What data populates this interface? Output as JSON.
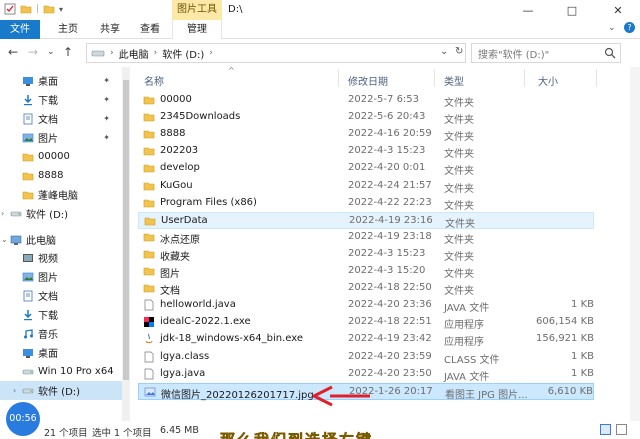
{
  "window": {
    "tools_tab": "图片工具",
    "title": "D:\\",
    "controls": [
      "—",
      "□",
      "✕"
    ]
  },
  "ribbon": {
    "tabs": [
      "文件",
      "主页",
      "共享",
      "查看",
      "管理"
    ]
  },
  "address": {
    "crumbs": [
      "此电脑",
      "软件 (D:)"
    ],
    "search_placeholder": "搜索\"软件 (D:)\""
  },
  "sidebar": {
    "items": [
      {
        "label": "桌面",
        "icon": "desktop-icon",
        "pinned": true
      },
      {
        "label": "下载",
        "icon": "download-icon",
        "pinned": true
      },
      {
        "label": "文档",
        "icon": "document-icon",
        "pinned": true
      },
      {
        "label": "图片",
        "icon": "picture-icon",
        "pinned": true
      },
      {
        "label": "00000",
        "icon": "folder-icon",
        "pinned": false
      },
      {
        "label": "8888",
        "icon": "folder-icon",
        "pinned": false
      },
      {
        "label": "蓬峰电脑",
        "icon": "folder-icon",
        "pinned": false
      },
      {
        "label": "软件 (D:)",
        "icon": "drive-icon",
        "pinned": false
      },
      {
        "label": "此电脑",
        "icon": "computer-icon",
        "pinned": false
      },
      {
        "label": "视频",
        "icon": "video-icon",
        "pinned": false
      },
      {
        "label": "图片",
        "icon": "picture-icon",
        "pinned": false
      },
      {
        "label": "文档",
        "icon": "document-icon",
        "pinned": false
      },
      {
        "label": "下载",
        "icon": "download-icon",
        "pinned": false
      },
      {
        "label": "音乐",
        "icon": "music-icon",
        "pinned": false
      },
      {
        "label": "桌面",
        "icon": "desktop-icon",
        "pinned": false
      },
      {
        "label": "Win 10 Pro x64",
        "icon": "drive-icon",
        "pinned": false
      },
      {
        "label": "软件 (D:)",
        "icon": "drive-icon",
        "pinned": false
      }
    ]
  },
  "columns": {
    "name": "名称",
    "date": "修改日期",
    "type": "类型",
    "size": "大小"
  },
  "files": [
    {
      "name": "00000",
      "date": "2022-5-7 6:53",
      "type": "文件夹",
      "size": "",
      "icon": "folder-icon"
    },
    {
      "name": "2345Downloads",
      "date": "2022-5-6 20:43",
      "type": "文件夹",
      "size": "",
      "icon": "folder-icon"
    },
    {
      "name": "8888",
      "date": "2022-4-16 20:59",
      "type": "文件夹",
      "size": "",
      "icon": "folder-icon"
    },
    {
      "name": "202203",
      "date": "2022-4-3 15:23",
      "type": "文件夹",
      "size": "",
      "icon": "folder-icon"
    },
    {
      "name": "develop",
      "date": "2022-4-20 0:01",
      "type": "文件夹",
      "size": "",
      "icon": "folder-icon"
    },
    {
      "name": "KuGou",
      "date": "2022-4-24 21:57",
      "type": "文件夹",
      "size": "",
      "icon": "folder-icon"
    },
    {
      "name": "Program Files (x86)",
      "date": "2022-4-22 22:23",
      "type": "文件夹",
      "size": "",
      "icon": "folder-icon"
    },
    {
      "name": "UserData",
      "date": "2022-4-19 23:16",
      "type": "文件夹",
      "size": "",
      "icon": "folder-icon"
    },
    {
      "name": "冰点还原",
      "date": "2022-4-19 23:18",
      "type": "文件夹",
      "size": "",
      "icon": "folder-icon"
    },
    {
      "name": "收藏夹",
      "date": "2022-4-3 15:23",
      "type": "文件夹",
      "size": "",
      "icon": "folder-icon"
    },
    {
      "name": "图片",
      "date": "2022-4-3 15:20",
      "type": "文件夹",
      "size": "",
      "icon": "folder-icon"
    },
    {
      "name": "文档",
      "date": "2022-4-18 22:50",
      "type": "文件夹",
      "size": "",
      "icon": "folder-icon"
    },
    {
      "name": "helloworld.java",
      "date": "2022-4-20 23:36",
      "type": "JAVA 文件",
      "size": "1 KB",
      "icon": "java-file-icon"
    },
    {
      "name": "idealC-2022.1.exe",
      "date": "2022-4-18 22:51",
      "type": "应用程序",
      "size": "606,154 KB",
      "icon": "idea-exe-icon"
    },
    {
      "name": "jdk-18_windows-x64_bin.exe",
      "date": "2022-4-19 23:42",
      "type": "应用程序",
      "size": "156,921 KB",
      "icon": "jdk-exe-icon"
    },
    {
      "name": "lgya.class",
      "date": "2022-4-20 23:59",
      "type": "CLASS 文件",
      "size": "1 KB",
      "icon": "class-file-icon"
    },
    {
      "name": "lgya.java",
      "date": "2022-4-20 23:50",
      "type": "JAVA 文件",
      "size": "1 KB",
      "icon": "java-file-icon"
    },
    {
      "name": "微信图片_20220126201717.jpg",
      "date": "2022-1-26 20:17",
      "type": "看图王 JPG 图片...",
      "size": "6,610 KB",
      "icon": "image-file-icon"
    }
  ],
  "status": {
    "count": "21 个项目",
    "selected": "选中 1 个项目",
    "size": "6.45 MB",
    "timer": "00:56"
  },
  "caption": "那么我们到选择右键",
  "colors": {
    "accent": "#1979ca",
    "selection": "#cce8ff",
    "arrow": "#e0202a"
  }
}
